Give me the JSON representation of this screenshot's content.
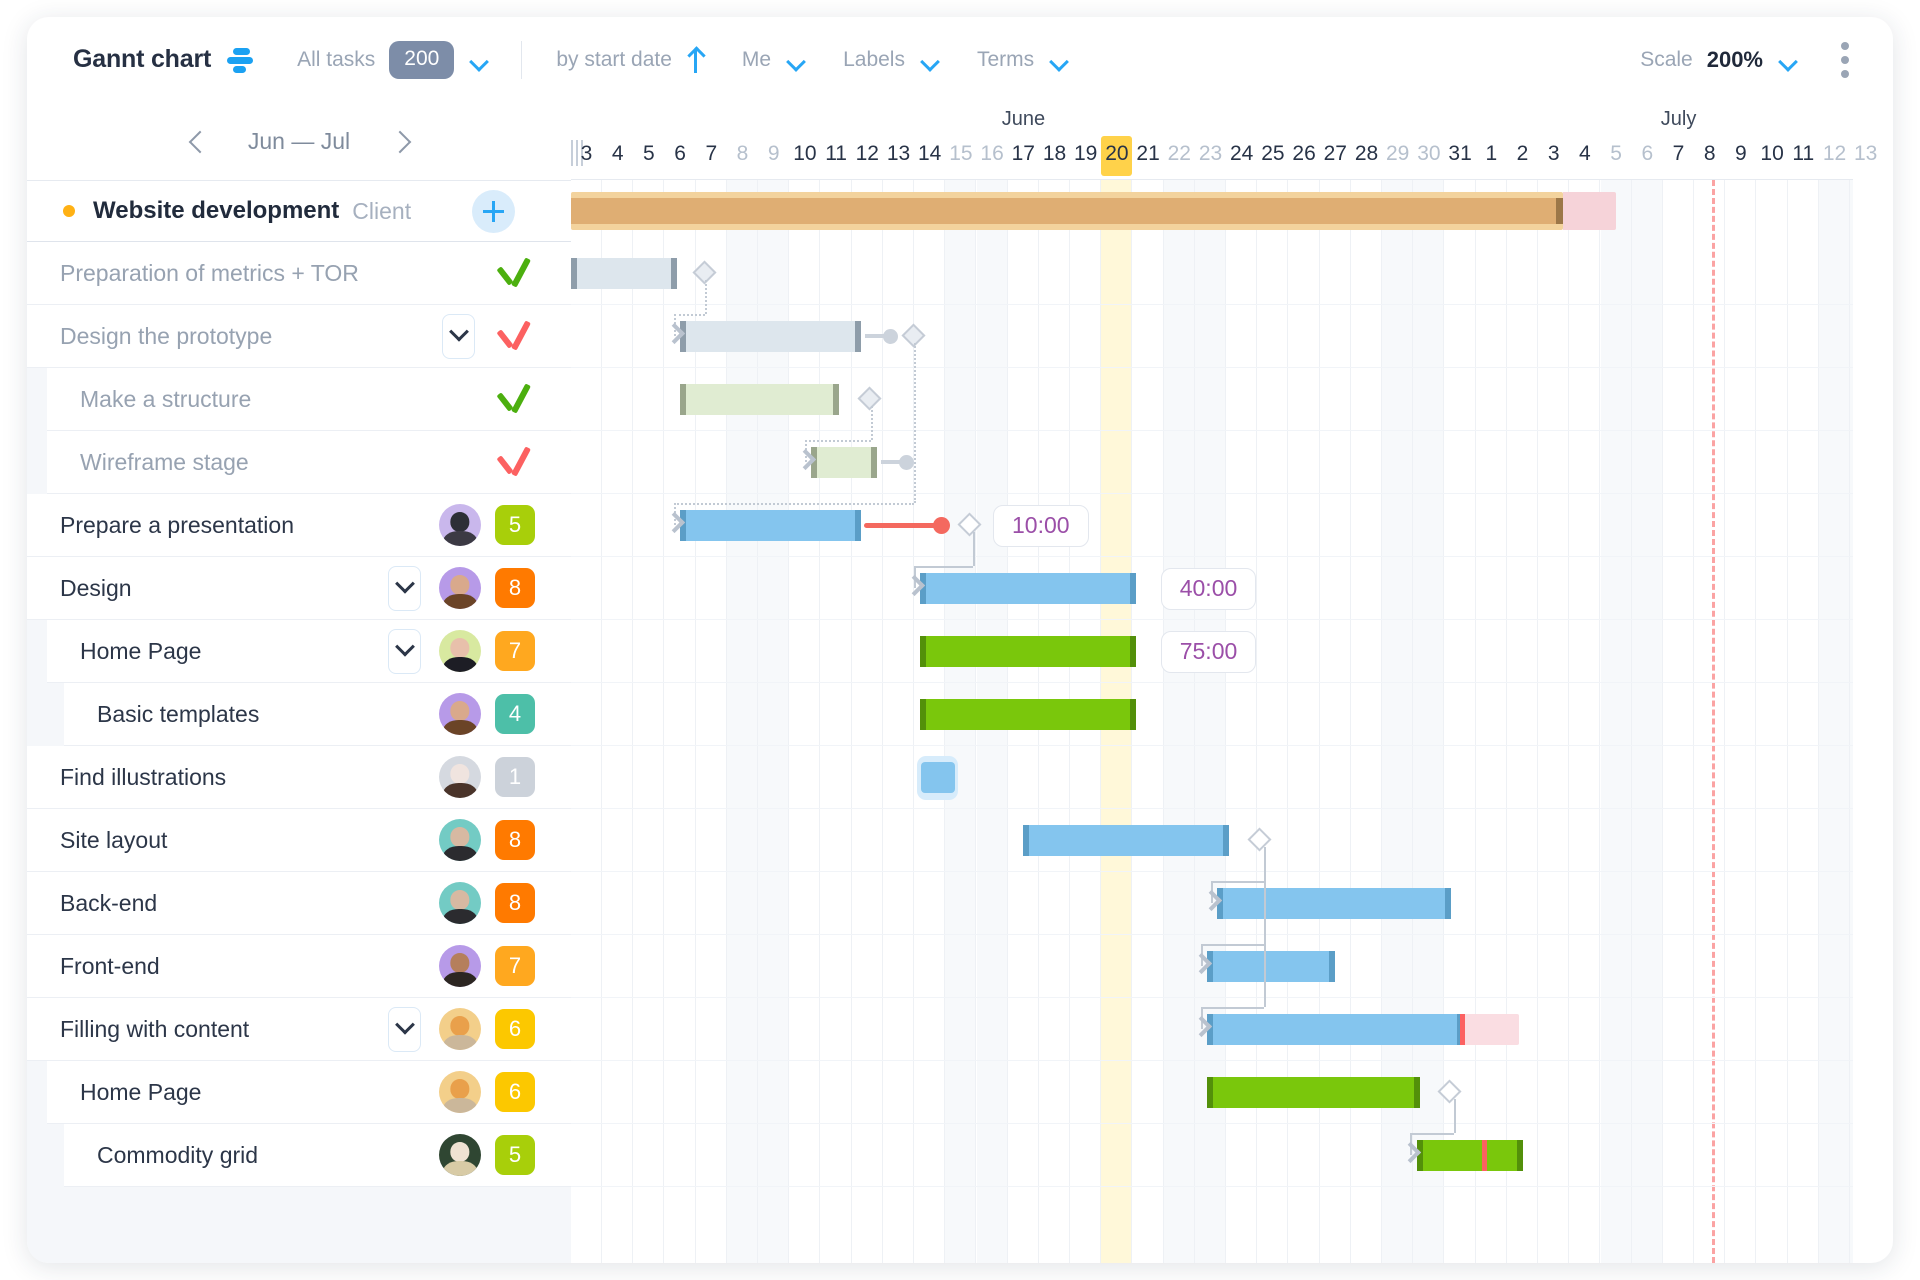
{
  "toolbar": {
    "title": "Gannt chart",
    "logo_icon": "gantt-logo-icon",
    "all_tasks_label": "All tasks",
    "all_tasks_count": "200",
    "sort_label": "by start date",
    "sort_direction_icon": "arrow-up-icon",
    "me_label": "Me",
    "labels_label": "Labels",
    "terms_label": "Terms",
    "scale_label": "Scale",
    "scale_value": "200%",
    "more_icon": "kebab-menu-icon",
    "chevron_icon": "chevron-down-icon"
  },
  "nav": {
    "prev_icon": "chevron-left-icon",
    "next_icon": "chevron-right-icon",
    "range_label": "Jun — Jul"
  },
  "timeline": {
    "months": [
      {
        "name": "June",
        "start_index": 0,
        "span": 29
      },
      {
        "name": "July",
        "start_index": 29,
        "span": 13
      }
    ],
    "days": [
      {
        "label": "3",
        "weekend": false
      },
      {
        "label": "4",
        "weekend": false
      },
      {
        "label": "5",
        "weekend": false
      },
      {
        "label": "6",
        "weekend": false
      },
      {
        "label": "7",
        "weekend": false
      },
      {
        "label": "8",
        "weekend": true
      },
      {
        "label": "9",
        "weekend": true
      },
      {
        "label": "10",
        "weekend": false
      },
      {
        "label": "11",
        "weekend": false
      },
      {
        "label": "12",
        "weekend": false
      },
      {
        "label": "13",
        "weekend": false
      },
      {
        "label": "14",
        "weekend": false
      },
      {
        "label": "15",
        "weekend": true
      },
      {
        "label": "16",
        "weekend": true
      },
      {
        "label": "17",
        "weekend": false
      },
      {
        "label": "18",
        "weekend": false
      },
      {
        "label": "19",
        "weekend": false
      },
      {
        "label": "20",
        "weekend": false,
        "today": true
      },
      {
        "label": "21",
        "weekend": false
      },
      {
        "label": "22",
        "weekend": true
      },
      {
        "label": "23",
        "weekend": true
      },
      {
        "label": "24",
        "weekend": false
      },
      {
        "label": "25",
        "weekend": false
      },
      {
        "label": "26",
        "weekend": false
      },
      {
        "label": "27",
        "weekend": false
      },
      {
        "label": "28",
        "weekend": false
      },
      {
        "label": "29",
        "weekend": true
      },
      {
        "label": "30",
        "weekend": true
      },
      {
        "label": "31",
        "weekend": false
      },
      {
        "label": "1",
        "weekend": false
      },
      {
        "label": "2",
        "weekend": false
      },
      {
        "label": "3",
        "weekend": false
      },
      {
        "label": "4",
        "weekend": false
      },
      {
        "label": "5",
        "weekend": true
      },
      {
        "label": "6",
        "weekend": true
      },
      {
        "label": "7",
        "weekend": false
      },
      {
        "label": "8",
        "weekend": false
      },
      {
        "label": "9",
        "weekend": false
      },
      {
        "label": "10",
        "weekend": false
      },
      {
        "label": "11",
        "weekend": false
      },
      {
        "label": "12",
        "weekend": true
      },
      {
        "label": "13",
        "weekend": true
      }
    ],
    "today_index": 17,
    "today_marker_index": 28,
    "deadline_index": 36,
    "colors": {
      "today_highlight": "#ffd24a",
      "today_column": "#fff8d9",
      "deadline_line": "#fba3a3",
      "bar_blue": "#84c5ee",
      "bar_green": "#7ac70c",
      "bar_done_blue": "#dde6ed",
      "bar_done_green": "#e0ecd2",
      "bar_overdue": "#fadde2",
      "project_bar": "#dfae73",
      "project_overdue": "#f6d3d9"
    }
  },
  "project": {
    "status_dot": "#ffb114",
    "name": "Website development",
    "client_label": "Client",
    "add_icon": "plus-icon",
    "bar": {
      "start": 0,
      "end": 31.8,
      "overflow_end": 33.5
    }
  },
  "rows": [
    {
      "name": "Preparation of metrics + TOR",
      "level": 0,
      "state": "done",
      "check": "green",
      "bar": {
        "start": 0,
        "end": 3.4,
        "style": "done-blue"
      },
      "milestone": 4.0
    },
    {
      "name": "Design the prototype",
      "level": 0,
      "state": "done",
      "collapse": true,
      "check": "red",
      "bar": {
        "start": 3.5,
        "end": 9.3,
        "style": "done-blue"
      },
      "milestone": 10.7,
      "tail_dot": true
    },
    {
      "name": "Make a structure",
      "level": 1,
      "state": "done",
      "check": "green",
      "bar": {
        "start": 3.5,
        "end": 8.6,
        "style": "done-green"
      },
      "milestone": 9.3
    },
    {
      "name": "Wireframe stage",
      "level": 1,
      "state": "done",
      "check": "red",
      "bar": {
        "start": 7.7,
        "end": 9.8,
        "style": "done-green"
      },
      "tail_dot": true
    },
    {
      "name": "Prepare a presentation",
      "level": 0,
      "state": "active",
      "avatar": "man-short-hair",
      "badge": "5",
      "badge_color": "#a8cf0a",
      "bar": {
        "start": 3.5,
        "end": 9.3,
        "style": "blue"
      },
      "red_line": {
        "from": 9.4,
        "to": 11.9
      },
      "milestone": 12.5
    },
    {
      "name": "Design",
      "level": 0,
      "state": "active",
      "collapse": true,
      "avatar": "woman-brown-curls",
      "badge": "8",
      "badge_color": "#ff7a00",
      "bar": {
        "start": 11.2,
        "end": 18.1,
        "style": "blue"
      },
      "time_badge": "40:00"
    },
    {
      "name": "Home Page",
      "level": 1,
      "state": "active",
      "collapse": true,
      "avatar": "woman-dark-hair",
      "badge": "7",
      "badge_color": "#ffa81f",
      "bar": {
        "start": 11.2,
        "end": 18.1,
        "style": "green"
      },
      "time_badge": "75:00"
    },
    {
      "name": "Basic templates",
      "level": 2,
      "state": "active",
      "avatar": "woman-brown-curls",
      "badge": "4",
      "badge_color": "#4dbfa8",
      "bar": {
        "start": 11.2,
        "end": 18.1,
        "style": "green"
      }
    },
    {
      "name": "Find illustrations",
      "level": 0,
      "state": "active",
      "avatar": "woman-asian",
      "badge": "1",
      "badge_color": "#ccd2da",
      "ghost_bar": {
        "start": 11.1,
        "end": 12.4
      }
    },
    {
      "name": "Site layout",
      "level": 0,
      "state": "active",
      "avatar": "man-beanie",
      "badge": "8",
      "badge_color": "#ff7a00",
      "bar": {
        "start": 14.5,
        "end": 21.1,
        "style": "blue"
      },
      "milestone": 21.8
    },
    {
      "name": "Back-end",
      "level": 0,
      "state": "active",
      "avatar": "man-beanie",
      "badge": "8",
      "badge_color": "#ff7a00",
      "bar": {
        "start": 20.7,
        "end": 28.2,
        "style": "blue"
      }
    },
    {
      "name": "Front-end",
      "level": 0,
      "state": "active",
      "avatar": "man-beard",
      "badge": "7",
      "badge_color": "#ffa81f",
      "bar": {
        "start": 20.4,
        "end": 24.5,
        "style": "blue"
      }
    },
    {
      "name": "Filling with content",
      "level": 0,
      "state": "active",
      "collapse": true,
      "avatar": "woman-blond-curls",
      "badge": "6",
      "badge_color": "#fcc800",
      "bar": {
        "start": 20.4,
        "end": 28.6,
        "style": "blue",
        "red_mark": 28.5,
        "overdue_to": 30.4
      }
    },
    {
      "name": "Home Page",
      "level": 1,
      "state": "active",
      "avatar": "woman-blond-curls",
      "badge": "6",
      "badge_color": "#fcc800",
      "bar": {
        "start": 20.4,
        "end": 27.2,
        "style": "green"
      },
      "milestone": 27.9
    },
    {
      "name": "Commodity grid",
      "level": 2,
      "state": "active",
      "avatar": "woman-glasses",
      "badge": "5",
      "badge_color": "#a8cf0a",
      "bar": {
        "start": 27.1,
        "end": 30.5,
        "style": "green",
        "red_mark": 29.2
      }
    }
  ]
}
